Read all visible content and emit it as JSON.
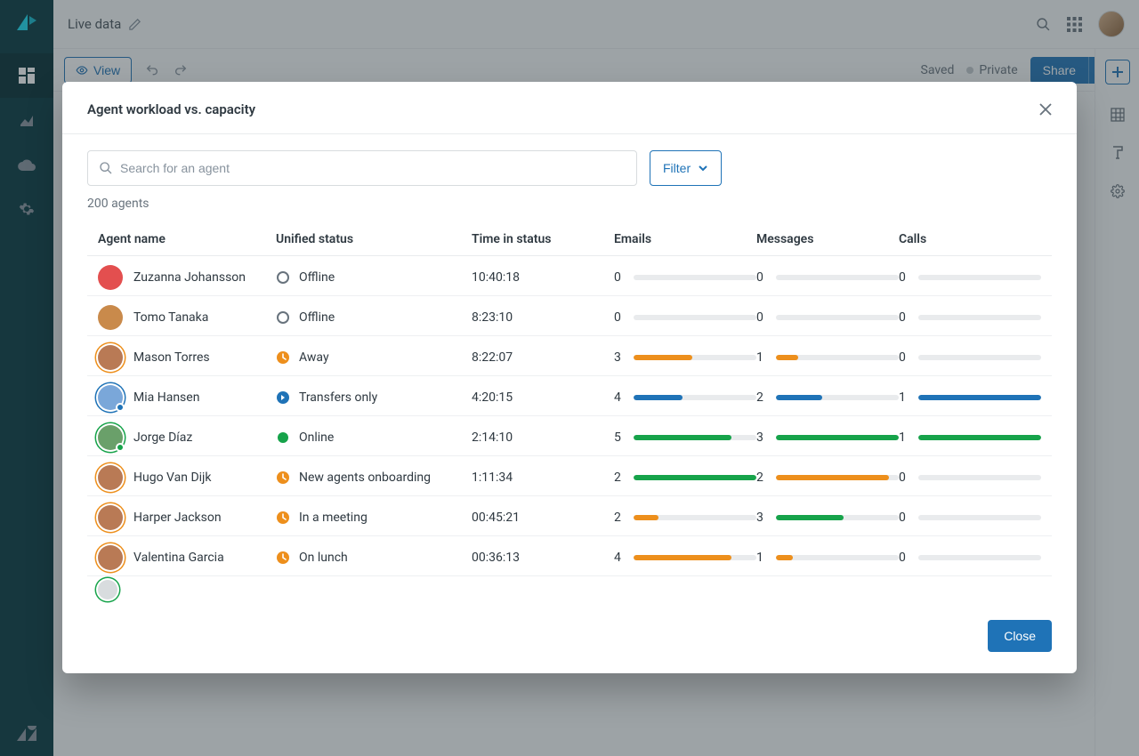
{
  "colors": {
    "green": "#16a34a",
    "orange": "#ed8f1c",
    "blue": "#1f73b7",
    "grey": "#e9ebed"
  },
  "topbar": {
    "title": "Live data"
  },
  "toolbar": {
    "view": "View",
    "saved": "Saved",
    "private": "Private",
    "share": "Share"
  },
  "modal": {
    "title": "Agent workload vs. capacity",
    "search_placeholder": "Search for an agent",
    "filter": "Filter",
    "count": "200 agents",
    "close": "Close",
    "headers": {
      "agent": "Agent name",
      "status": "Unified status",
      "time": "Time in status",
      "emails": "Emails",
      "messages": "Messages",
      "calls": "Calls"
    },
    "rows": [
      {
        "name": "Zuzanna Johansson",
        "ring": "",
        "avatarColor": "#e34f4f",
        "status": "Offline",
        "statusIcon": "offline",
        "time": "10:40:18",
        "emails": {
          "v": 0,
          "pct": 0,
          "c": "grey"
        },
        "messages": {
          "v": 0,
          "pct": 0,
          "c": "grey"
        },
        "calls": {
          "v": 0,
          "pct": 0,
          "c": "grey"
        }
      },
      {
        "name": "Tomo Tanaka",
        "ring": "",
        "avatarColor": "#c98a4b",
        "status": "Offline",
        "statusIcon": "offline",
        "time": "8:23:10",
        "emails": {
          "v": 0,
          "pct": 0,
          "c": "grey"
        },
        "messages": {
          "v": 0,
          "pct": 0,
          "c": "grey"
        },
        "calls": {
          "v": 0,
          "pct": 0,
          "c": "grey"
        }
      },
      {
        "name": "Mason Torres",
        "ring": "orange",
        "avatarColor": "#b97a55",
        "status": "Away",
        "statusIcon": "away",
        "time": "8:22:07",
        "emails": {
          "v": 3,
          "pct": 48,
          "c": "orange"
        },
        "messages": {
          "v": 1,
          "pct": 18,
          "c": "orange"
        },
        "calls": {
          "v": 0,
          "pct": 0,
          "c": "grey"
        }
      },
      {
        "name": "Mia Hansen",
        "ring": "blue",
        "avatarColor": "#7aa7d9",
        "dot": "blue",
        "status": "Transfers only",
        "statusIcon": "transfers",
        "time": "4:20:15",
        "emails": {
          "v": 4,
          "pct": 40,
          "c": "blue"
        },
        "messages": {
          "v": 2,
          "pct": 38,
          "c": "blue"
        },
        "calls": {
          "v": 1,
          "pct": 100,
          "c": "blue"
        }
      },
      {
        "name": "Jorge Díaz",
        "ring": "green",
        "avatarColor": "#6aa06a",
        "dot": "green",
        "status": "Online",
        "statusIcon": "online",
        "time": "2:14:10",
        "emails": {
          "v": 5,
          "pct": 80,
          "c": "green"
        },
        "messages": {
          "v": 3,
          "pct": 100,
          "c": "green"
        },
        "calls": {
          "v": 1,
          "pct": 100,
          "c": "green"
        }
      },
      {
        "name": "Hugo Van Dijk",
        "ring": "orange",
        "avatarColor": "#b97a55",
        "status": "New agents onboarding",
        "statusIcon": "away",
        "time": "1:11:34",
        "emails": {
          "v": 2,
          "pct": 100,
          "c": "green"
        },
        "messages": {
          "v": 2,
          "pct": 92,
          "c": "orange"
        },
        "calls": {
          "v": 0,
          "pct": 0,
          "c": "grey"
        }
      },
      {
        "name": "Harper Jackson",
        "ring": "orange",
        "avatarColor": "#b97a55",
        "status": "In a meeting",
        "statusIcon": "away",
        "time": "00:45:21",
        "emails": {
          "v": 2,
          "pct": 20,
          "c": "orange"
        },
        "messages": {
          "v": 3,
          "pct": 55,
          "c": "green"
        },
        "calls": {
          "v": 0,
          "pct": 0,
          "c": "grey"
        }
      },
      {
        "name": "Valentina Garcia",
        "ring": "orange",
        "avatarColor": "#b97a55",
        "status": "On lunch",
        "statusIcon": "away",
        "time": "00:36:13",
        "emails": {
          "v": 4,
          "pct": 80,
          "c": "orange"
        },
        "messages": {
          "v": 1,
          "pct": 14,
          "c": "orange"
        },
        "calls": {
          "v": 0,
          "pct": 0,
          "c": "grey"
        }
      }
    ]
  }
}
